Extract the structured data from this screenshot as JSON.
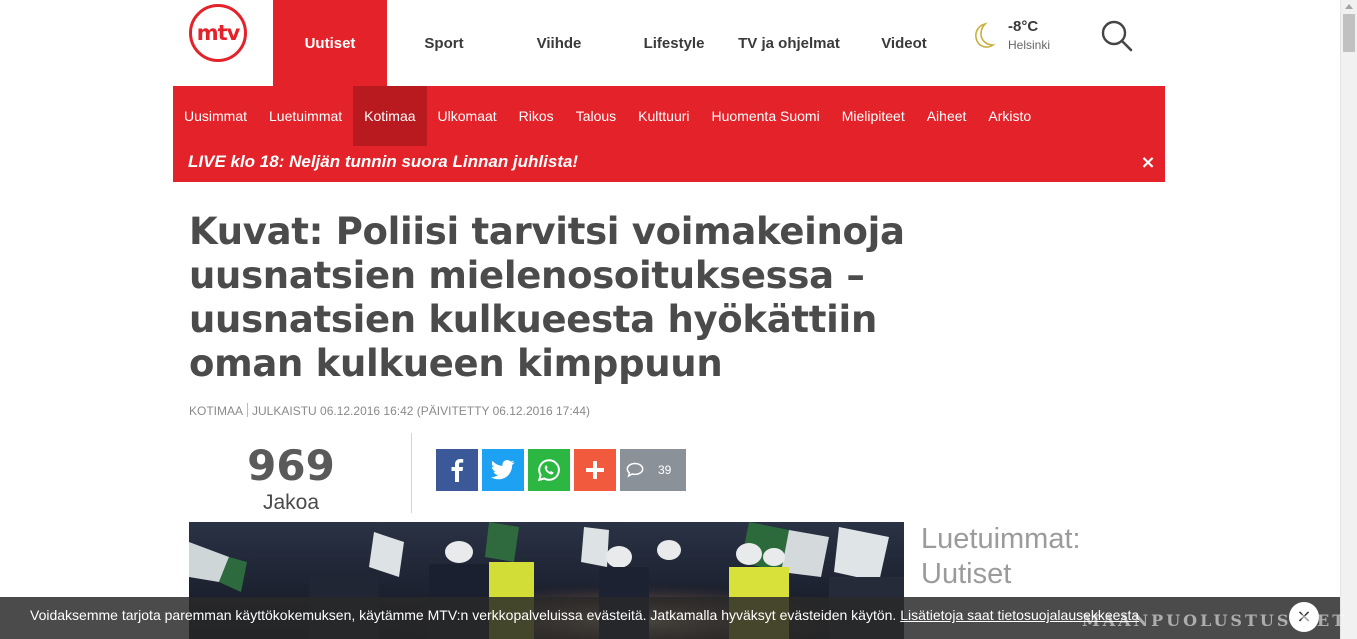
{
  "header": {
    "logo_text": "mtv",
    "nav": [
      {
        "label": "Uutiset",
        "active": true
      },
      {
        "label": "Sport",
        "active": false
      },
      {
        "label": "Viihde",
        "active": false
      },
      {
        "label": "Lifestyle",
        "active": false
      },
      {
        "label": "TV ja ohjelmat",
        "active": false
      },
      {
        "label": "Videot",
        "active": false
      }
    ],
    "weather": {
      "temp": "-8°C",
      "city": "Helsinki",
      "icon": "moon-icon"
    },
    "search_icon": "search-icon"
  },
  "subnav": {
    "items": [
      {
        "label": "Uusimmat",
        "active": false
      },
      {
        "label": "Luetuimmat",
        "active": false
      },
      {
        "label": "Kotimaa",
        "active": true
      },
      {
        "label": "Ulkomaat",
        "active": false
      },
      {
        "label": "Rikos",
        "active": false
      },
      {
        "label": "Talous",
        "active": false
      },
      {
        "label": "Kulttuuri",
        "active": false
      },
      {
        "label": "Huomenta Suomi",
        "active": false
      },
      {
        "label": "Mielipiteet",
        "active": false
      },
      {
        "label": "Aiheet",
        "active": false
      },
      {
        "label": "Arkisto",
        "active": false
      }
    ],
    "live_banner": "LIVE klo 18: Neljän tunnin suora Linnan juhlista!",
    "live_close": "×"
  },
  "article": {
    "headline": "Kuvat: Poliisi tarvitsi voimakeinoja uusnatsien mielenosoituksessa – uusnatsien kulkueesta hyökättiin oman kulkueen kimppuun",
    "category": "KOTIMAA",
    "published": "JULKAISTU 06.12.2016 16:42 (PÄIVITETTY 06.12.2016 17:44)",
    "share_count": "969",
    "share_label": "Jakoa",
    "comment_count": "39"
  },
  "sidebar": {
    "title": "Luetuimmat: Uutiset"
  },
  "cookie": {
    "text": "Voidaksemme tarjota paremman käyttökokemuksen, käytämme MTV:n verkkopalveluissa evästeitä. Jatkamalla hyväksyt evästeiden käytön.",
    "link": "Lisätietoja saat tietosuojalausekkeesta",
    "close": "×"
  },
  "watermark": "MAANPUOLUSTUS.NET",
  "colors": {
    "brand_red": "#e32229",
    "active_sub": "#b91a20",
    "facebook": "#3b5998",
    "twitter": "#1da1f2",
    "whatsapp": "#2cb742",
    "plus": "#f25a3e",
    "comments": "#8a9199"
  }
}
